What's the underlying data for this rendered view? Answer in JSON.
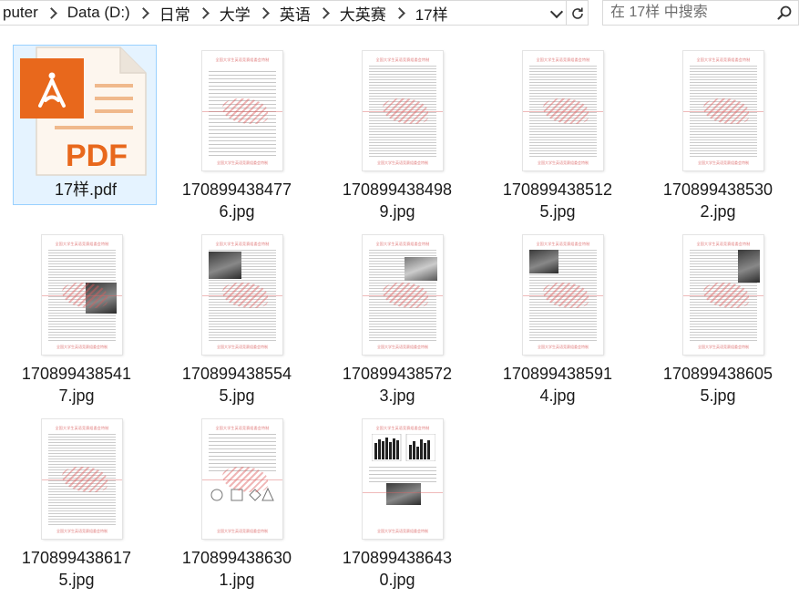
{
  "address": {
    "crumbs": [
      "puter",
      "Data (D:)",
      "日常",
      "大学",
      "英语",
      "大英赛",
      "17样"
    ]
  },
  "search": {
    "placeholder": "在 17样 中搜索"
  },
  "pdf_icon": {
    "label": "PDF",
    "color": "#e8681c"
  },
  "thumb_header": "全国大学生英语竞赛组委会特制",
  "files": [
    {
      "name": "17样.pdf",
      "type": "pdf"
    },
    {
      "name": "1708994384776.jpg",
      "type": "jpg",
      "display": "170899438477\n6.jpg"
    },
    {
      "name": "1708994384989.jpg",
      "type": "jpg",
      "display": "170899438498\n9.jpg"
    },
    {
      "name": "1708994385125.jpg",
      "type": "jpg",
      "display": "170899438512\n5.jpg"
    },
    {
      "name": "1708994385302.jpg",
      "type": "jpg",
      "display": "170899438530\n2.jpg"
    },
    {
      "name": "1708994385417.jpg",
      "type": "jpg",
      "display": "170899438541\n7.jpg"
    },
    {
      "name": "1708994385545.jpg",
      "type": "jpg",
      "display": "170899438554\n5.jpg"
    },
    {
      "name": "1708994385723.jpg",
      "type": "jpg",
      "display": "170899438572\n3.jpg"
    },
    {
      "name": "1708994385914.jpg",
      "type": "jpg",
      "display": "170899438591\n4.jpg"
    },
    {
      "name": "1708994386055.jpg",
      "type": "jpg",
      "display": "170899438605\n5.jpg"
    },
    {
      "name": "1708994386175.jpg",
      "type": "jpg",
      "display": "170899438617\n5.jpg"
    },
    {
      "name": "1708994386301.jpg",
      "type": "jpg",
      "display": "170899438630\n1.jpg"
    },
    {
      "name": "1708994386430.jpg",
      "type": "jpg",
      "display": "170899438643\n0.jpg"
    }
  ],
  "colors": {
    "selection_bg": "#e5f3ff",
    "selection_border": "#99d1ff",
    "watermark": "#e07c7c"
  }
}
